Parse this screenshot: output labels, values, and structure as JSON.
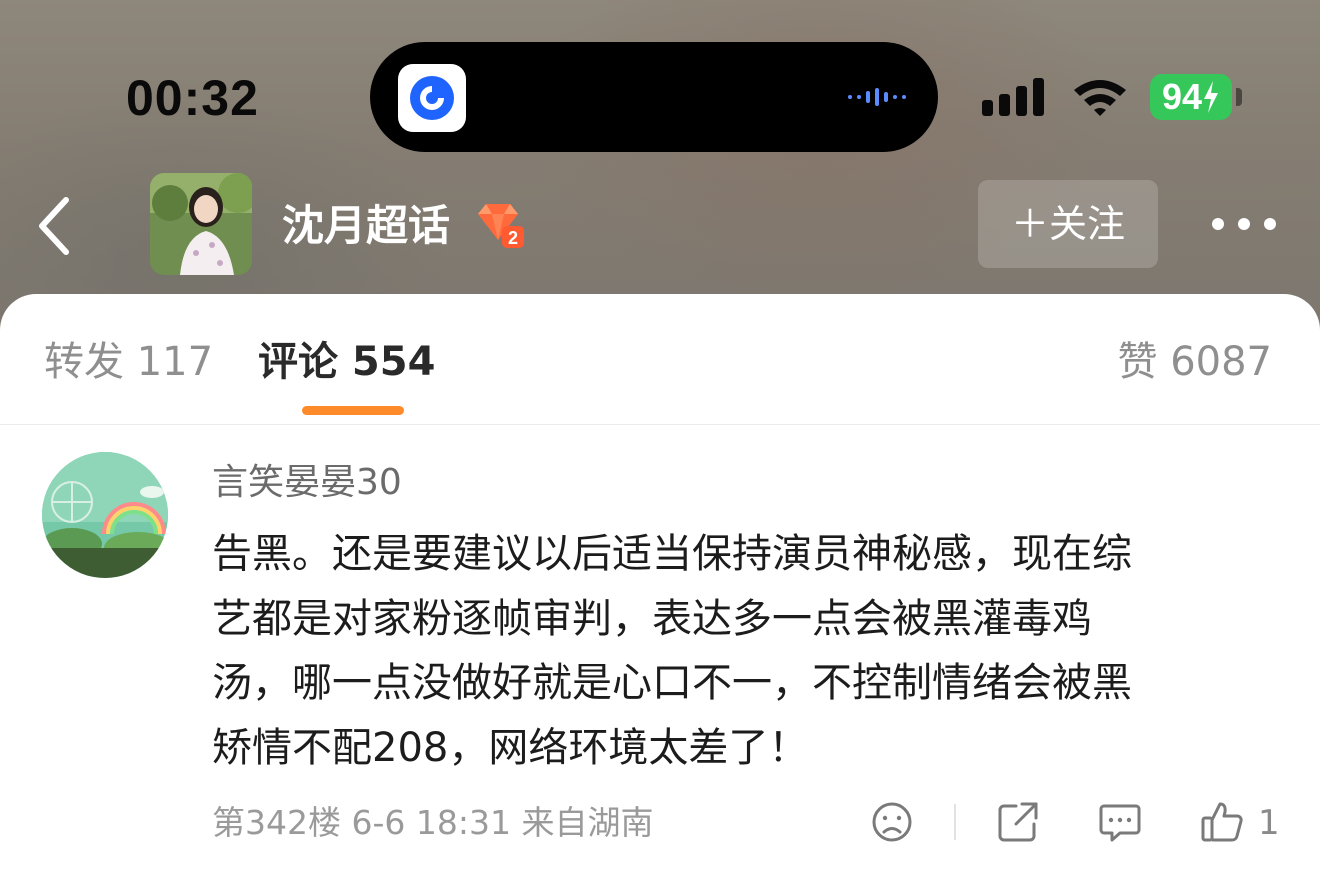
{
  "status_bar": {
    "time": "00:32",
    "battery": "94",
    "app_icon": "blue-circle-app-icon",
    "signal_icon": "cellular-signal-icon",
    "wifi_icon": "wifi-icon",
    "charging_icon": "bolt-icon"
  },
  "nav": {
    "back_icon": "chevron-left-icon",
    "title": "沈月超话",
    "level_badge_icon": "diamond-level-2-icon",
    "follow_label": "＋关注",
    "more_icon": "more-dots-icon"
  },
  "tabs": {
    "repost": "转发 117",
    "comments": "评论 554",
    "likes": "赞 6087",
    "indicator_color": "#ff8a2a"
  },
  "comment": {
    "username": "言笑晏晏30",
    "lines": [
      "告黑。还是要建议以后适当保持演员神秘感，现在综",
      "艺都是对家粉逐帧审判，表达多一点会被黑灌毒鸡",
      "汤，哪一点没做好就是心口不一，不控制情绪会被黑",
      "矫情不配208，网络环境太差了！"
    ],
    "meta": "第342楼 6-6 18:31 来自湖南",
    "like_count": "1",
    "actions": [
      "frown-face-icon",
      "share-icon",
      "comment-bubble-icon",
      "thumbs-up-icon"
    ]
  },
  "colors": {
    "accent_orange": "#ff8a2a",
    "battery_green": "#35c759"
  }
}
